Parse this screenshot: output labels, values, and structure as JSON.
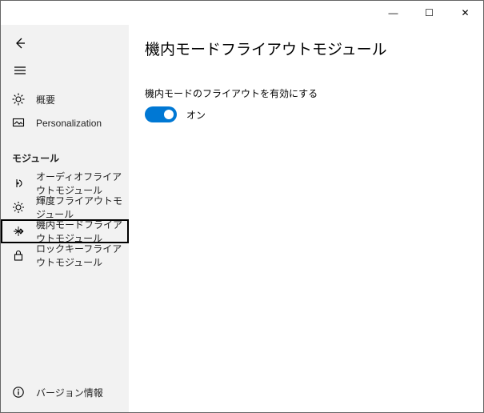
{
  "window": {
    "minimize_glyph": "—",
    "maximize_glyph": "☐",
    "close_glyph": "✕"
  },
  "page": {
    "title": "機内モードフライアウトモジュール"
  },
  "sidebar": {
    "overview": "概要",
    "personalization": "Personalization",
    "modules_header": "モジュール",
    "audio": "オーディオフライアウトモジュール",
    "brightness": "輝度フライアウトモジュール",
    "airplane": "機内モードフライアウトモジュール",
    "lockkeys": "ロックキーフライアウトモジュール",
    "version": "バージョン情報"
  },
  "setting": {
    "label": "機内モードのフライアウトを有効にする",
    "state": "オン"
  }
}
